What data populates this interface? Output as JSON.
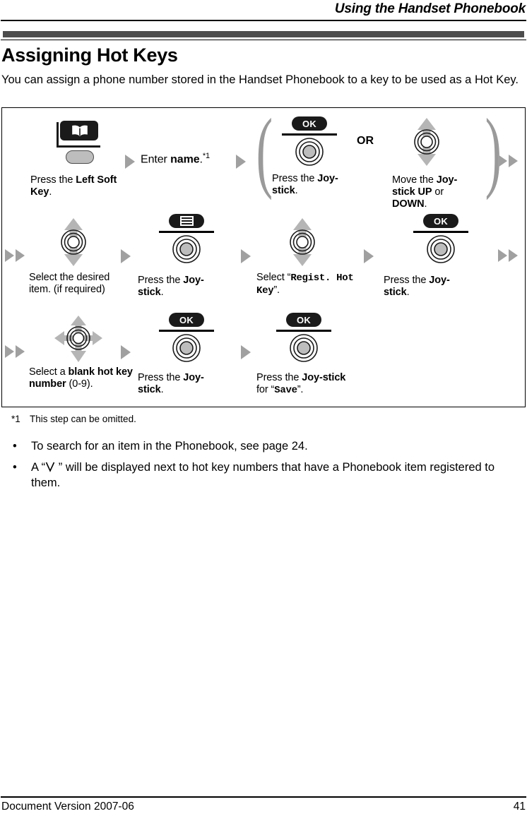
{
  "header": {
    "title": "Using the Handset Phonebook"
  },
  "section": {
    "title": "Assigning Hot Keys",
    "intro": "You can assign a phone number stored in the Handset Phonebook to a key to be used as a Hot Key."
  },
  "diagram": {
    "row1": {
      "step1": {
        "art": "left-soft-key",
        "icon": "phonebook-book-icon",
        "label_prefix": "Press the ",
        "label_bold": "Left Soft Key",
        "label_suffix": "."
      },
      "step2": {
        "label_prefix": "Enter ",
        "label_bold": "name",
        "label_suffix": ".",
        "footnote_mark": "*1"
      },
      "or_label": "OR",
      "step3": {
        "art": "ok-joystick",
        "pill": "OK",
        "label_prefix": "Press the ",
        "label_bold": "Joy-stick",
        "label_suffix": "."
      },
      "step4": {
        "art": "updown-joystick",
        "label_prefix": "Move the ",
        "label_bold1": "Joy-stick UP",
        "label_mid": " or ",
        "label_bold2": "DOWN",
        "label_suffix": "."
      }
    },
    "row2": {
      "step1": {
        "art": "updown-joystick",
        "label_line1": "Select the desired",
        "label_line2": "item. (if required)"
      },
      "step2": {
        "art": "menu-joystick",
        "pill_icon": "menu-list-icon",
        "label_prefix": "Press the ",
        "label_bold": "Joy-stick",
        "label_suffix": "."
      },
      "step3": {
        "art": "updown-joystick",
        "label_prefix": "Select “",
        "label_mono": "Regist. Hot Key",
        "label_suffix": "”."
      },
      "step4": {
        "art": "ok-joystick",
        "pill": "OK",
        "label_prefix": "Press the ",
        "label_bold": "Joy-stick",
        "label_suffix": "."
      }
    },
    "row3": {
      "step1": {
        "art": "fourway-joystick",
        "label_prefix": "Select a ",
        "label_bold": "blank hot key number",
        "label_suffix": " (0-9)."
      },
      "step2": {
        "art": "ok-joystick",
        "pill": "OK",
        "label_prefix": "Press the ",
        "label_bold": "Joy-stick",
        "label_suffix": "."
      },
      "step3": {
        "art": "ok-joystick",
        "pill": "OK",
        "label_prefix": "Press the ",
        "label_bold": "Joy-stick",
        "label_mid": " for “",
        "label_mono": "Save",
        "label_suffix": "”."
      }
    }
  },
  "notes": {
    "footnote_mark": "*1",
    "footnote_text": "This step can be omitted.",
    "bullet1_dot": "•",
    "bullet1_text": "To search for an item in the Phonebook, see page 24.",
    "bullet2_dot": "•",
    "bullet2_prefix": "A “",
    "bullet2_suffix": " ” will be displayed next to hot key numbers that have a Phonebook item registered to them."
  },
  "footer": {
    "document_version": "Document Version 2007-06",
    "page_number": "41"
  },
  "colors": {
    "section_bar": "#4d4d4d",
    "arrow_gray": "#a0a0a0",
    "icon_dark": "#1a1a1a",
    "softkey_gray": "#bdbdbd"
  }
}
